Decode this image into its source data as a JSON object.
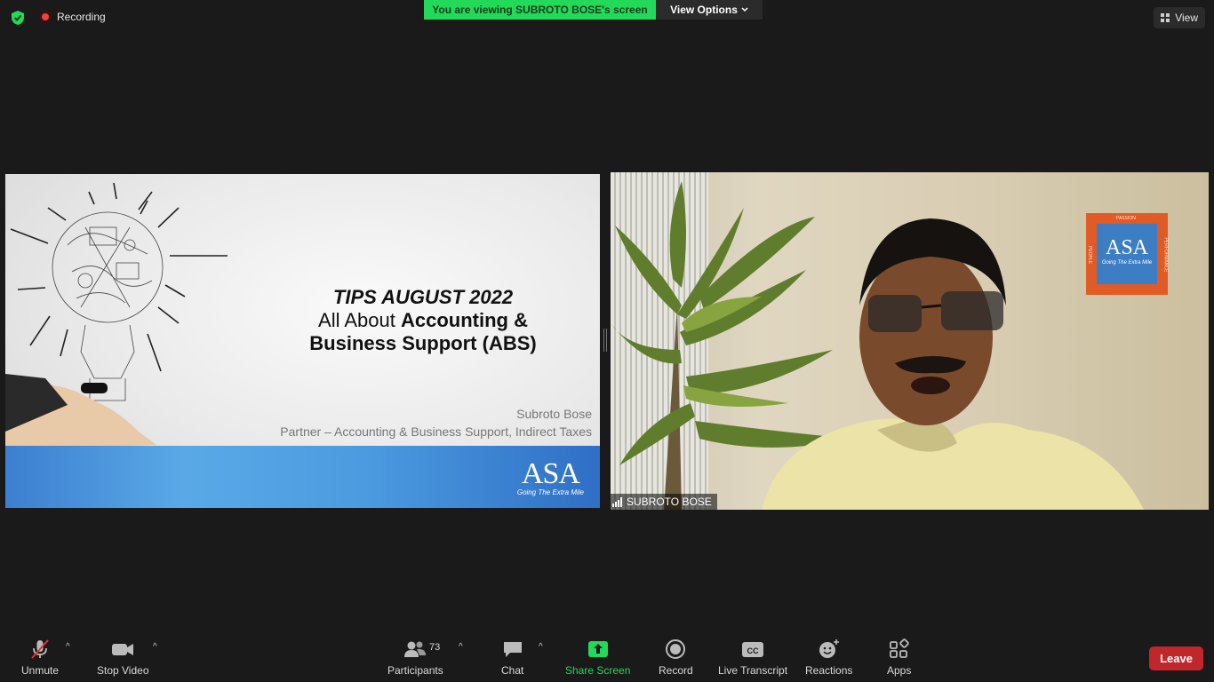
{
  "top_bar": {
    "recording_label": "Recording",
    "viewing_banner": "You are viewing SUBROTO BOSE's screen",
    "view_options_label": "View Options",
    "view_button_label": "View"
  },
  "slide": {
    "title_line1": "TIPS AUGUST 2022",
    "title_line2_prefix": "All About ",
    "title_line2_bold": "Accounting &",
    "title_line3": "Business Support (ABS)",
    "presenter_name": "Subroto Bose",
    "presenter_role": "Partner – Accounting & Business Support, Indirect Taxes",
    "logo_text": "ASA",
    "logo_tagline": "Going The Extra Mile"
  },
  "video": {
    "participant_name": "SUBROTO BOSE",
    "poster_logo": "ASA",
    "poster_tagline": "Going The Extra Mile",
    "poster_top": "PASSION",
    "poster_left": "PEOPLE",
    "poster_right": "PERFORMANCE"
  },
  "toolbar": {
    "unmute_label": "Unmute",
    "stop_video_label": "Stop Video",
    "participants_label": "Participants",
    "participants_count": "73",
    "chat_label": "Chat",
    "share_screen_label": "Share Screen",
    "record_label": "Record",
    "live_transcript_label": "Live Transcript",
    "reactions_label": "Reactions",
    "apps_label": "Apps",
    "leave_label": "Leave"
  },
  "colors": {
    "banner_green": "#23d959",
    "share_green": "#23d959",
    "leave_red": "#c0272d",
    "background": "#1a1a1a"
  }
}
